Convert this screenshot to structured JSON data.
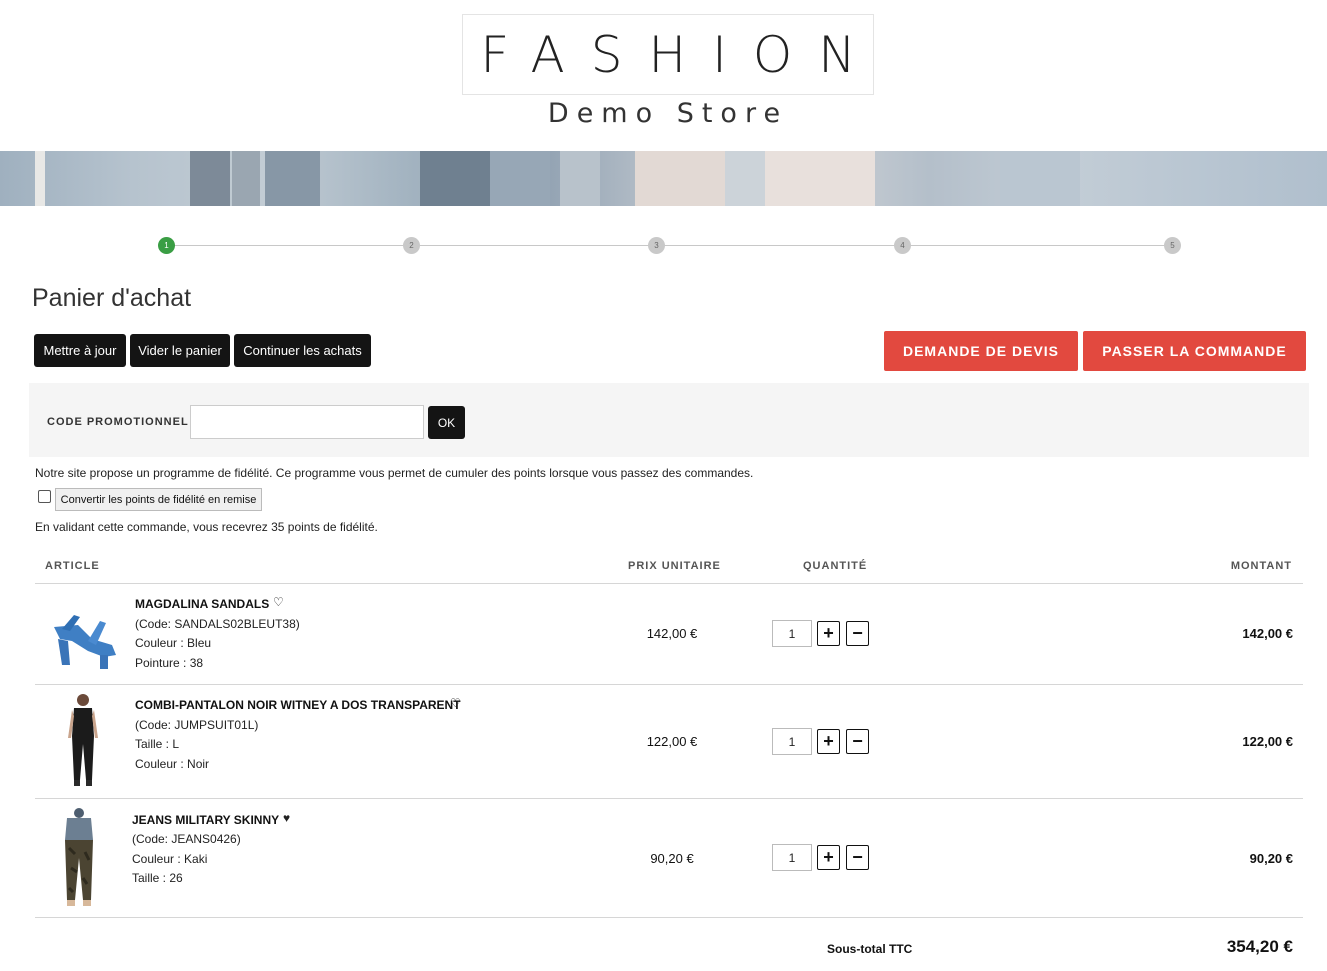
{
  "logo": {
    "title": "FASHION",
    "subtitle": "Demo Store"
  },
  "steps": [
    "1",
    "2",
    "3",
    "4",
    "5"
  ],
  "page_title": "Panier d'achat",
  "actions": {
    "update": "Mettre à jour",
    "empty": "Vider le panier",
    "continue": "Continuer les achats",
    "quote": "DEMANDE DE DEVIS",
    "checkout": "PASSER LA COMMANDE"
  },
  "promo": {
    "label": "CODE PROMOTIONNEL :",
    "value": "",
    "ok": "OK"
  },
  "loyalty": {
    "info": "Notre site propose un programme de fidélité. Ce programme vous permet de cumuler des points lorsque vous passez des commandes.",
    "convert_label": "Convertir les points de fidélité en remise",
    "points_msg": "En validant cette commande, vous recevrez 35 points de fidélité."
  },
  "table": {
    "headers": {
      "article": "ARTICLE",
      "unit_price": "PRIX UNITAIRE",
      "quantity": "QUANTITÉ",
      "amount": "MONTANT"
    },
    "rows": [
      {
        "name": "MAGDALINA SANDALS",
        "code": "(Code: SANDALS02BLEUT38)",
        "attr1": "Couleur : Bleu",
        "attr2": "Pointure : 38",
        "price": "142,00 €",
        "qty": "1",
        "amount": "142,00 €",
        "favorite": false
      },
      {
        "name": "COMBI-PANTALON NOIR WITNEY A DOS TRANSPARENT",
        "code": "(Code: JUMPSUIT01L)",
        "attr1": "Taille : L",
        "attr2": "Couleur : Noir",
        "price": "122,00 €",
        "qty": "1",
        "amount": "122,00 €",
        "favorite": false
      },
      {
        "name": "JEANS MILITARY SKINNY",
        "code": "(Code: JEANS0426)",
        "attr1": "Couleur : Kaki",
        "attr2": "Taille : 26",
        "price": "90,20 €",
        "qty": "1",
        "amount": "90,20 €",
        "favorite": true
      }
    ],
    "qty_plus": "+",
    "qty_minus": "−",
    "heart_outline": "♡",
    "heart_filled": "♥"
  },
  "subtotal": {
    "label": "Sous-total TTC",
    "value": "354,20 €"
  },
  "colors": {
    "accent_red": "#e2493f",
    "step_active": "#3a9e44",
    "button_dark": "#141414"
  }
}
